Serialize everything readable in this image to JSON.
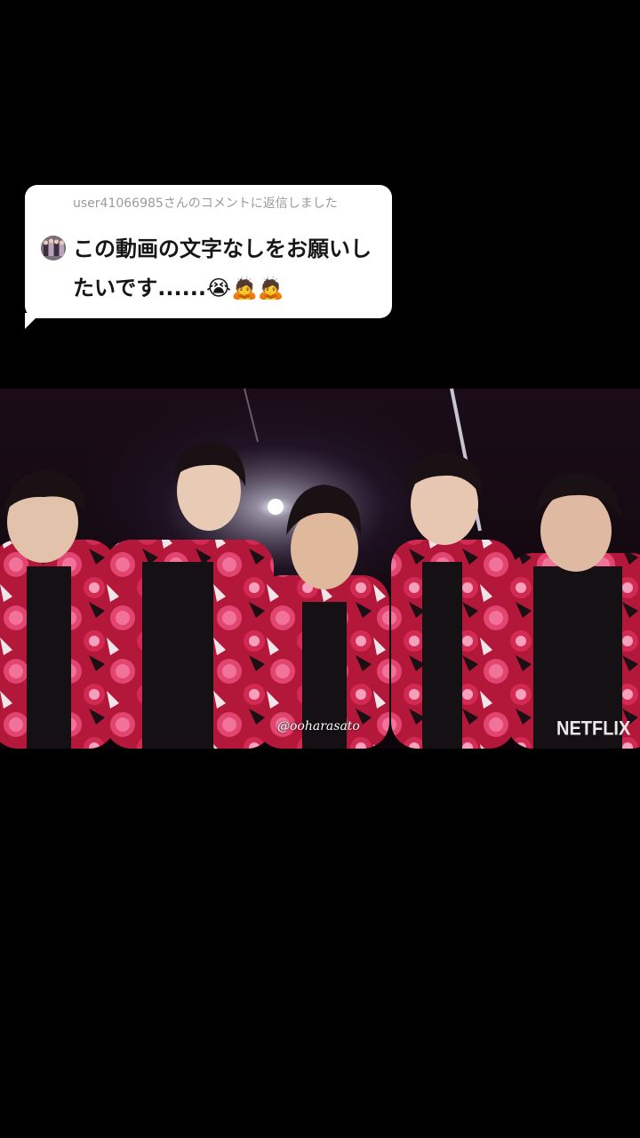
{
  "reply": {
    "header": "user41066985さんのコメントに返信しました",
    "text": "この動画の文字なしをお願いしたいです......",
    "emojis": [
      "😭",
      "🙇",
      "🙇"
    ],
    "bubble_color": "#ffffff",
    "header_color": "#9a9a9a",
    "text_color": "#161616"
  },
  "video": {
    "watermark": "@ooharasato",
    "brand": "NETFLIX",
    "dominant_colors": [
      "#14080f",
      "#c41e3a",
      "#e0407a",
      "#1a1a1a"
    ]
  },
  "icons": {
    "avatar": "user-avatar-icon"
  }
}
